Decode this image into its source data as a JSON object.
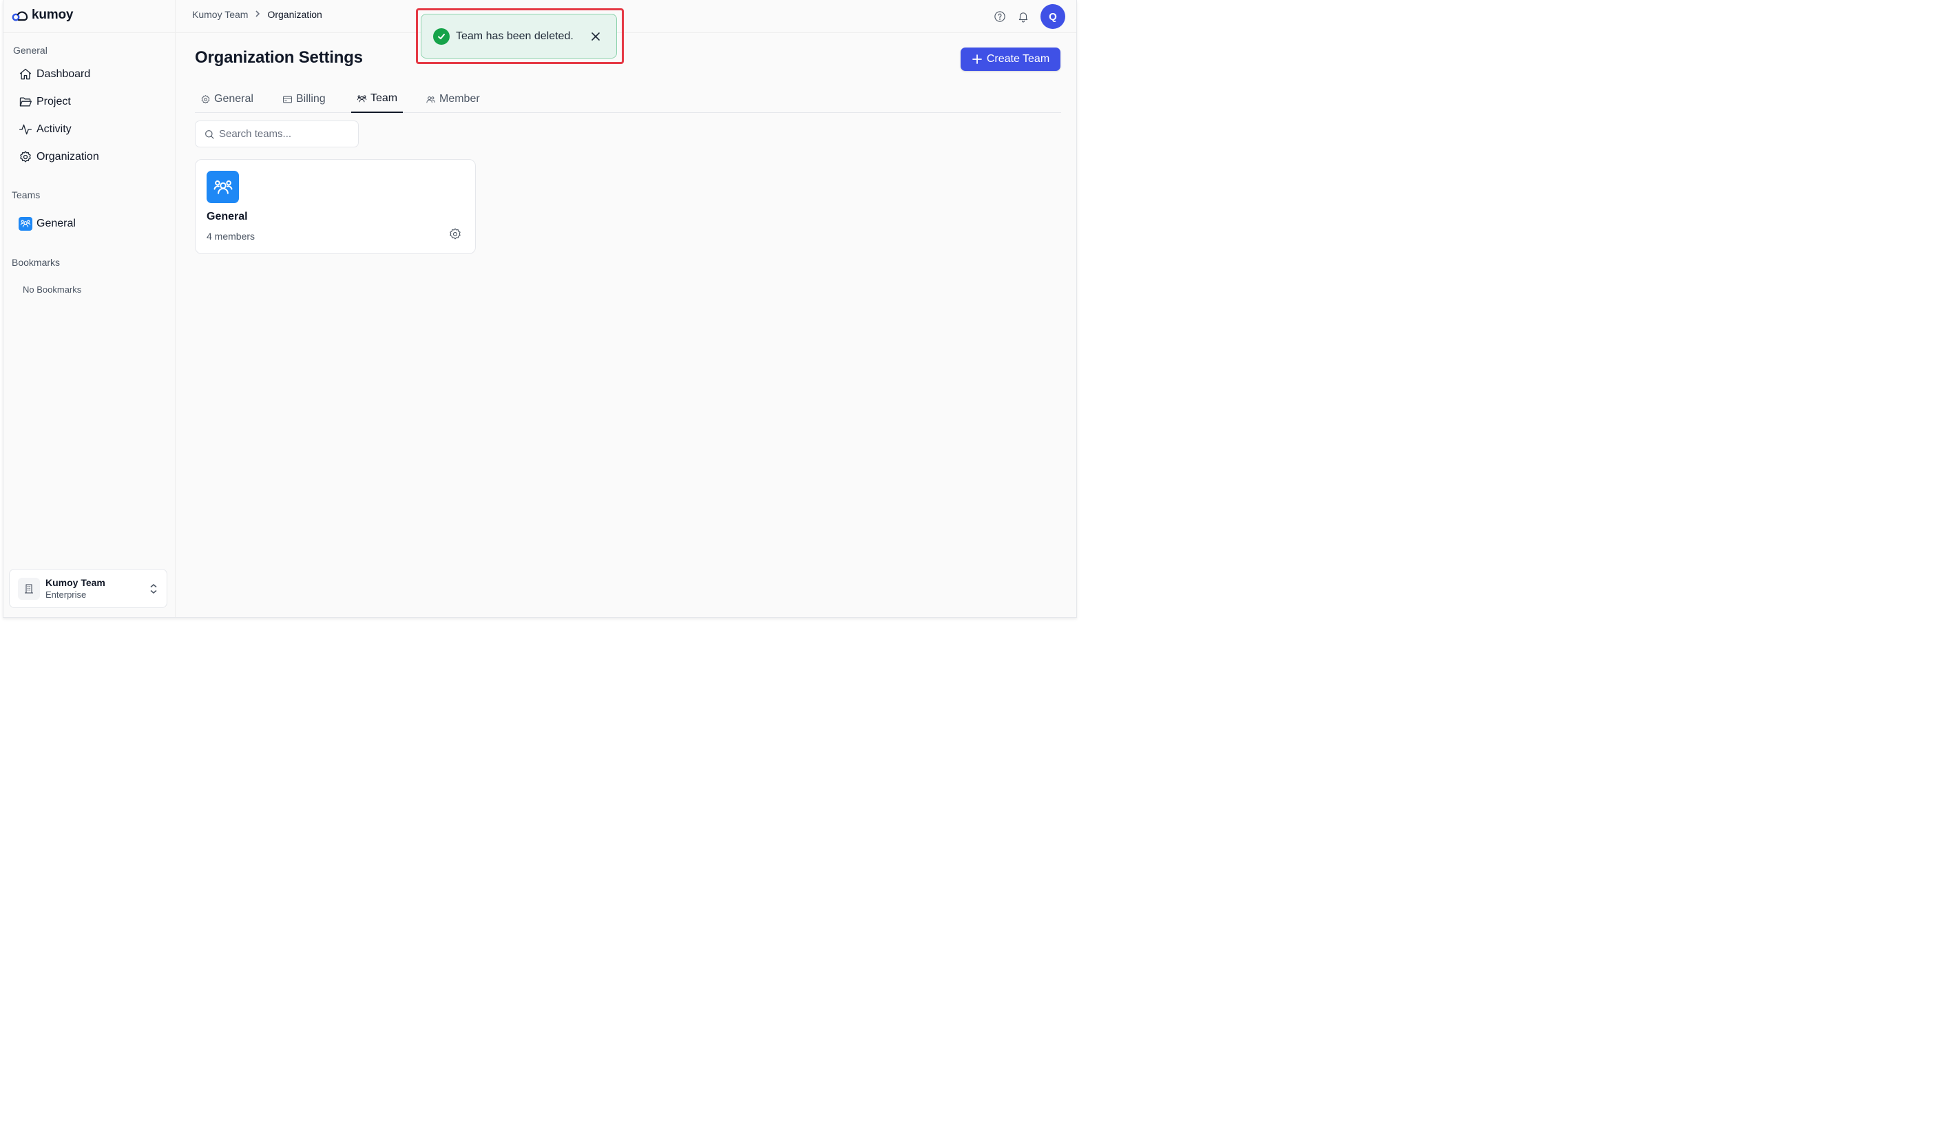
{
  "app": {
    "logo_text": "kumoy"
  },
  "sidebar": {
    "general_label": "General",
    "nav": [
      {
        "label": "Dashboard",
        "icon": "home-icon"
      },
      {
        "label": "Project",
        "icon": "folder-icon"
      },
      {
        "label": "Activity",
        "icon": "activity-icon"
      },
      {
        "label": "Organization",
        "icon": "gear-icon"
      }
    ],
    "teams_label": "Teams",
    "teams": [
      {
        "label": "General",
        "icon": "team-icon"
      }
    ],
    "bookmarks_label": "Bookmarks",
    "no_bookmarks": "No Bookmarks",
    "org_switcher": {
      "name": "Kumoy Team",
      "plan": "Enterprise"
    }
  },
  "topbar": {
    "breadcrumb": [
      "Kumoy Team",
      "Organization"
    ],
    "avatar_initial": "Q"
  },
  "main": {
    "title": "Organization Settings",
    "create_button": "Create Team",
    "tabs": [
      {
        "label": "General",
        "icon": "gear-icon",
        "active": false
      },
      {
        "label": "Billing",
        "icon": "credit-card-icon",
        "active": false
      },
      {
        "label": "Team",
        "icon": "team-icon",
        "active": true
      },
      {
        "label": "Member",
        "icon": "users-icon",
        "active": false
      }
    ],
    "search": {
      "placeholder": "Search teams...",
      "value": ""
    },
    "team_cards": [
      {
        "name": "General",
        "members": "4 members"
      }
    ]
  },
  "toast": {
    "message": "Team has been deleted.",
    "status": "success"
  },
  "colors": {
    "primary": "#3f51e6",
    "team_blue": "#1e88f5",
    "success": "#16a34a",
    "highlight": "#e53945"
  }
}
